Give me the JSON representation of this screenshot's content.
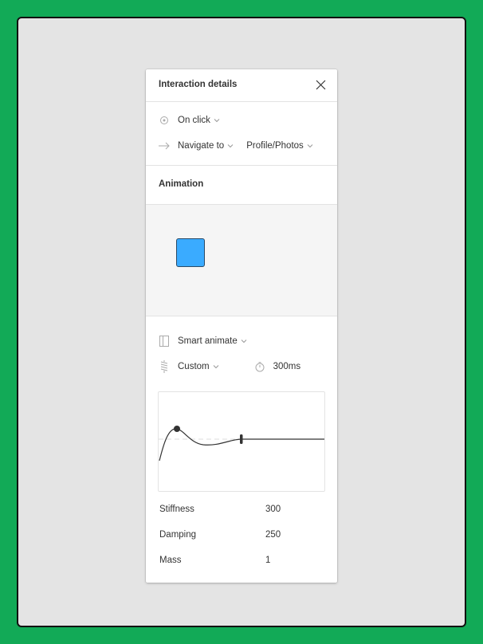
{
  "panel": {
    "title": "Interaction details",
    "close_icon": "close-icon"
  },
  "trigger": {
    "icon": "tap-target-icon",
    "label": "On click"
  },
  "action": {
    "icon": "arrow-right-icon",
    "label": "Navigate to",
    "destination": "Profile/Photos"
  },
  "animation": {
    "section_title": "Animation",
    "preview_box_color": "#3aabff",
    "transition_icon": "smart-animate-icon",
    "transition": "Smart animate",
    "easing_icon": "spring-icon",
    "easing": "Custom",
    "duration_icon": "timer-icon",
    "duration": "300ms"
  },
  "spring": {
    "properties": [
      {
        "label": "Stiffness",
        "value": "300"
      },
      {
        "label": "Damping",
        "value": "250"
      },
      {
        "label": "Mass",
        "value": "1"
      }
    ]
  }
}
